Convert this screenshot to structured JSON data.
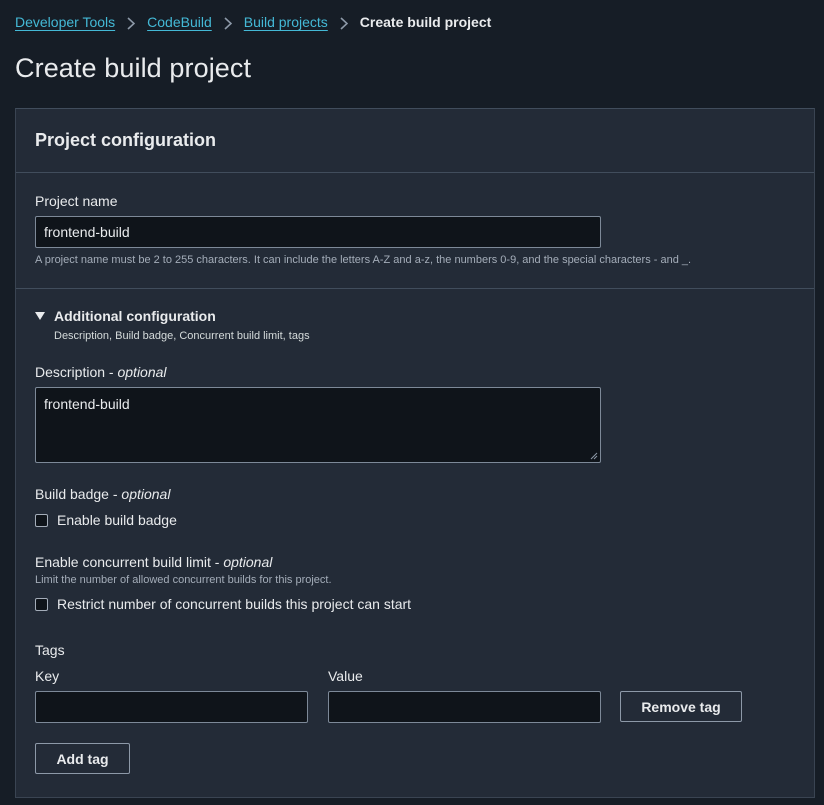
{
  "breadcrumb": {
    "items": [
      "Developer Tools",
      "CodeBuild",
      "Build projects"
    ],
    "current": "Create build project"
  },
  "page": {
    "title": "Create build project"
  },
  "panel": {
    "title": "Project configuration",
    "project_name": {
      "label": "Project name",
      "value": "frontend-build",
      "hint": "A project name must be 2 to 255 characters. It can include the letters A-Z and a-z, the numbers 0-9, and the special characters - and _."
    },
    "additional": {
      "title": "Additional configuration",
      "subtitle": "Description, Build badge, Concurrent build limit, tags"
    },
    "description": {
      "label": "Description",
      "optional": "optional",
      "value": "frontend-build"
    },
    "build_badge": {
      "label": "Build badge",
      "optional": "optional",
      "checkbox_label": "Enable build badge",
      "checked": false
    },
    "concurrent": {
      "label": "Enable concurrent build limit",
      "optional": "optional",
      "hint": "Limit the number of allowed concurrent builds for this project.",
      "checkbox_label": "Restrict number of concurrent builds this project can start",
      "checked": false
    },
    "tags": {
      "label": "Tags",
      "key_label": "Key",
      "value_label": "Value",
      "key_value": "",
      "value_value": "",
      "remove_button": "Remove tag",
      "add_button": "Add tag"
    }
  },
  "colors": {
    "background": "#161d26",
    "panel": "#232b37",
    "link": "#44b9d6",
    "input_bg": "#0f141a"
  }
}
